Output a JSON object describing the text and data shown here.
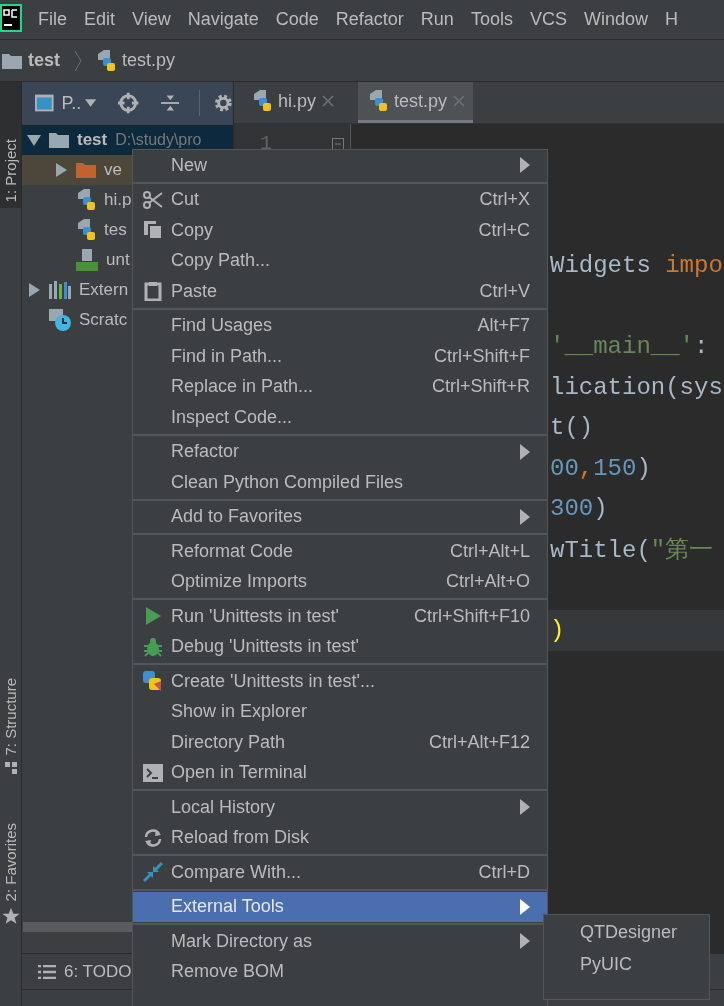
{
  "menu_bar": {
    "items": [
      "File",
      "Edit",
      "View",
      "Navigate",
      "Code",
      "Refactor",
      "Run",
      "Tools",
      "VCS",
      "Window",
      "H"
    ]
  },
  "breadcrumb": [
    {
      "label": "test"
    },
    {
      "label": "test.py"
    }
  ],
  "tool_stripe": {
    "tabs": [
      {
        "label": "1: Project",
        "selected": true
      },
      {
        "label": "7: Structure",
        "selected": false
      },
      {
        "label": "2: Favorites",
        "selected": false
      }
    ]
  },
  "project_panel": {
    "title": "P..",
    "tree": [
      {
        "label": "test",
        "path": "D:\\study\\pro",
        "kind": "folder",
        "expanded": true,
        "selected": true,
        "children": [
          {
            "label": "ve",
            "kind": "excluded-folder",
            "expanded": false,
            "selected": false
          },
          {
            "label": "hi.p",
            "kind": "python",
            "selected": false
          },
          {
            "label": "tes",
            "kind": "python",
            "selected": false
          },
          {
            "label": "unt",
            "kind": "qt",
            "selected": false
          }
        ]
      },
      {
        "label": "Extern",
        "kind": "libraries",
        "expanded": false,
        "selected": false
      },
      {
        "label": "Scratc",
        "kind": "scratches",
        "selected": false
      }
    ]
  },
  "editor": {
    "tabs": [
      {
        "label": "hi.py",
        "selected": false
      },
      {
        "label": "test.py",
        "selected": true
      }
    ],
    "line_numbers": [
      "1"
    ],
    "lines": [
      {
        "current": false
      },
      {
        "current": false
      },
      {
        "current": false
      },
      {
        "current": false,
        "segments": [
          {
            "text": "Widgets ",
            "kind": "plain"
          },
          {
            "text": "impo",
            "kind": "keyword"
          }
        ]
      },
      {
        "current": false
      },
      {
        "current": false,
        "segments": [
          {
            "text": "'__main__'",
            "kind": "string"
          },
          {
            "text": ":",
            "kind": "plain"
          }
        ]
      },
      {
        "current": false,
        "segments": [
          {
            "text": "lication(sys",
            "kind": "plain"
          }
        ]
      },
      {
        "current": false,
        "segments": [
          {
            "text": "t()",
            "kind": "plain"
          }
        ]
      },
      {
        "current": false,
        "segments": [
          {
            "text": "00",
            "kind": "number"
          },
          {
            "text": ",",
            "kind": "keyword"
          },
          {
            "text": "150",
            "kind": "number"
          },
          {
            "text": ")",
            "kind": "plain"
          }
        ]
      },
      {
        "current": false,
        "segments": [
          {
            "text": "300",
            "kind": "number"
          },
          {
            "text": ")",
            "kind": "plain"
          }
        ]
      },
      {
        "current": false,
        "segments": [
          {
            "text": "wTitle(",
            "kind": "plain"
          },
          {
            "text": "\"第一",
            "kind": "string"
          }
        ]
      },
      {
        "current": false
      },
      {
        "current": true,
        "segments": [
          {
            "text": ")",
            "kind": "brace"
          }
        ]
      }
    ]
  },
  "bottom_bar": {
    "label": "6: TODO"
  },
  "context_menu": {
    "groups": [
      {
        "items": [
          {
            "label": "New",
            "submenu": true,
            "selected": false
          }
        ]
      },
      {
        "items": [
          {
            "label": "Cut",
            "shortcut": "Ctrl+X",
            "submenu": false,
            "selected": false
          },
          {
            "label": "Copy",
            "shortcut": "Ctrl+C",
            "submenu": false,
            "selected": false
          },
          {
            "label": "Copy Path...",
            "submenu": false,
            "selected": false
          },
          {
            "label": "Paste",
            "shortcut": "Ctrl+V",
            "submenu": false,
            "selected": false
          }
        ]
      },
      {
        "items": [
          {
            "label": "Find Usages",
            "shortcut": "Alt+F7",
            "submenu": false,
            "selected": false
          },
          {
            "label": "Find in Path...",
            "shortcut": "Ctrl+Shift+F",
            "submenu": false,
            "selected": false
          },
          {
            "label": "Replace in Path...",
            "shortcut": "Ctrl+Shift+R",
            "submenu": false,
            "selected": false
          },
          {
            "label": "Inspect Code...",
            "submenu": false,
            "selected": false
          }
        ]
      },
      {
        "items": [
          {
            "label": "Refactor",
            "submenu": true,
            "selected": false
          },
          {
            "label": "Clean Python Compiled Files",
            "submenu": false,
            "selected": false
          }
        ]
      },
      {
        "items": [
          {
            "label": "Add to Favorites",
            "submenu": true,
            "selected": false
          }
        ]
      },
      {
        "items": [
          {
            "label": "Reformat Code",
            "shortcut": "Ctrl+Alt+L",
            "submenu": false,
            "selected": false
          },
          {
            "label": "Optimize Imports",
            "shortcut": "Ctrl+Alt+O",
            "submenu": false,
            "selected": false
          }
        ]
      },
      {
        "items": [
          {
            "label": "Run 'Unittests in test'",
            "shortcut": "Ctrl+Shift+F10",
            "submenu": false,
            "selected": false
          },
          {
            "label": "Debug 'Unittests in test'",
            "submenu": false,
            "selected": false
          }
        ]
      },
      {
        "items": [
          {
            "label": "Create 'Unittests in test'...",
            "submenu": false,
            "selected": false
          },
          {
            "label": "Show in Explorer",
            "submenu": false,
            "selected": false
          },
          {
            "label": "Directory Path",
            "shortcut": "Ctrl+Alt+F12",
            "submenu": false,
            "selected": false
          },
          {
            "label": "Open in Terminal",
            "submenu": false,
            "selected": false
          }
        ]
      },
      {
        "items": [
          {
            "label": "Local History",
            "submenu": true,
            "selected": false
          },
          {
            "label": "Reload from Disk",
            "submenu": false,
            "selected": false
          }
        ]
      },
      {
        "items": [
          {
            "label": "Compare With...",
            "shortcut": "Ctrl+D",
            "submenu": false,
            "selected": false
          }
        ]
      },
      {
        "items": [
          {
            "label": "External Tools",
            "submenu": true,
            "selected": true
          }
        ]
      },
      {
        "items": [
          {
            "label": "Mark Directory as",
            "submenu": true,
            "selected": false
          },
          {
            "label": "Remove BOM",
            "submenu": false,
            "selected": false
          }
        ]
      }
    ]
  },
  "submenu": {
    "items": [
      {
        "label": "QTDesigner"
      },
      {
        "label": "PyUIC"
      }
    ]
  }
}
